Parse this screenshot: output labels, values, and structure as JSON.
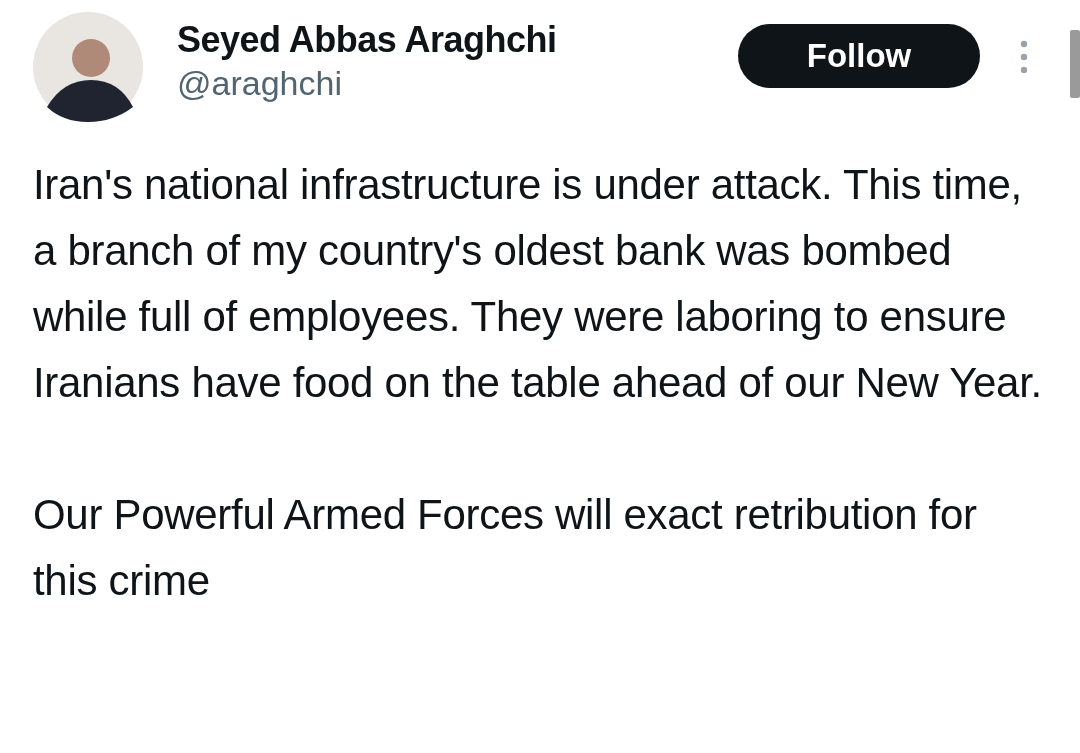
{
  "author": {
    "name": "Seyed Abbas Araghchi",
    "handle": "@araghchi"
  },
  "follow_button": {
    "label": "Follow"
  },
  "post": {
    "paragraphs": [
      "Iran's national infrastructure is under attack. This time, a branch of my country's oldest bank was bombed while full of employees. They were laboring to ensure Iranians have food on the table ahead of our New Year.",
      "Our Powerful Armed Forces will exact retribution for this crime"
    ]
  }
}
